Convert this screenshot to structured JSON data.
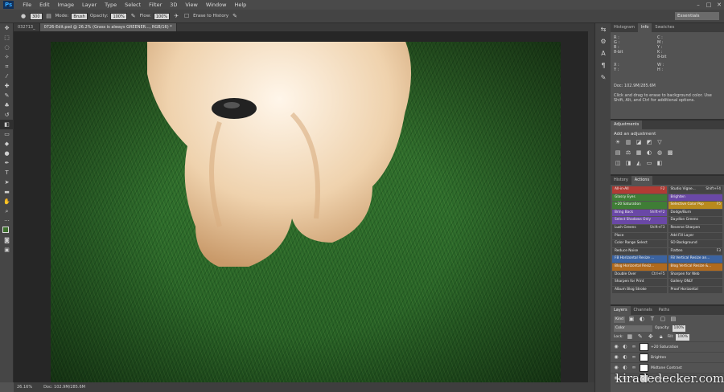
{
  "app": {
    "logo": "Ps"
  },
  "menu": [
    "File",
    "Edit",
    "Image",
    "Layer",
    "Type",
    "Select",
    "Filter",
    "3D",
    "View",
    "Window",
    "Help"
  ],
  "window_controls": [
    "–",
    "□",
    "✕"
  ],
  "options": {
    "size": "300",
    "mode_label": "Mode:",
    "mode_value": "Brush",
    "opacity_label": "Opacity:",
    "opacity_value": "100%",
    "flow_label": "Flow:",
    "flow_value": "100%",
    "erase_history": "Erase to History",
    "workspace": "Essentials"
  },
  "doc_tabs": [
    {
      "label": "032713_"
    },
    {
      "label": "0726-Edit.psd @ 26.2% (Grass is always GREENER..., RGB/16) *"
    }
  ],
  "status": {
    "zoom": "26.16%",
    "doc": "Doc: 102.9M/285.6M"
  },
  "info_panel": {
    "tabs": [
      "Histogram",
      "Info",
      "Swatches"
    ],
    "active_tab": "Info",
    "rgb_labels": [
      "R :",
      "G :",
      "B :"
    ],
    "bit_left": "8-bit",
    "cmyk_labels": [
      "C :",
      "M :",
      "Y :",
      "K :"
    ],
    "bit_right": "8-bit",
    "xy_labels": [
      "X :",
      "Y :"
    ],
    "wh_labels": [
      "W :",
      "H :"
    ],
    "doc": "Doc: 102.9M/285.6M",
    "hint": "Click and drag to erase to background color.  Use Shift, Alt, and Ctrl for additional options."
  },
  "adjustments": {
    "tab": "Adjustments",
    "title": "Add an adjustment"
  },
  "actions_panel": {
    "tabs": [
      "History",
      "Actions"
    ],
    "active_tab": "Actions",
    "items": [
      {
        "label": "All-in-All",
        "shortcut": "F2",
        "color": "#b03b34"
      },
      {
        "label": "Studio Vigne...",
        "shortcut": "Shift+F4",
        "color": "#444444"
      },
      {
        "label": "Glassy Eyes",
        "shortcut": "",
        "color": "#3f7d36"
      },
      {
        "label": "Brighten",
        "shortcut": "",
        "color": "#6a48a6"
      },
      {
        "label": "+20 Saturation",
        "shortcut": "",
        "color": "#3f7d36"
      },
      {
        "label": "Selective Color Pop",
        "shortcut": "F5",
        "color": "#b88a1e"
      },
      {
        "label": "Bring Back",
        "shortcut": "Shift+F2",
        "color": "#6a48a6"
      },
      {
        "label": "Dodge/Burn",
        "shortcut": "",
        "color": "#444444"
      },
      {
        "label": "Select Shadows Only",
        "shortcut": "",
        "color": "#6a48a6"
      },
      {
        "label": "Daydlon Greens",
        "shortcut": "",
        "color": "#444444"
      },
      {
        "label": "Lush Greens",
        "shortcut": "Shift+F3",
        "color": "#444444"
      },
      {
        "label": "Reverse Sharpen",
        "shortcut": "",
        "color": "#444444"
      },
      {
        "label": "Place",
        "shortcut": "",
        "color": "#444444"
      },
      {
        "label": "Add Fill Layer",
        "shortcut": "",
        "color": "#444444"
      },
      {
        "label": "Color Range Select",
        "shortcut": "",
        "color": "#444444"
      },
      {
        "label": "SO Background",
        "shortcut": "",
        "color": "#444444"
      },
      {
        "label": "Reduce Noise",
        "shortcut": "",
        "color": "#444444"
      },
      {
        "label": "Flatten",
        "shortcut": "F3",
        "color": "#444444"
      },
      {
        "label": "FB Horizontal Resize ...",
        "shortcut": "",
        "color": "#3b63a0"
      },
      {
        "label": "FB Vertical Resize an...",
        "shortcut": "",
        "color": "#3b63a0"
      },
      {
        "label": "Blog Horizontal Resiz...",
        "shortcut": "",
        "color": "#b06a1e"
      },
      {
        "label": "Blog Vertical Resize &...",
        "shortcut": "",
        "color": "#b06a1e"
      },
      {
        "label": "Double Over",
        "shortcut": "Ctrl+F5",
        "color": "#444444"
      },
      {
        "label": "Sharpen for Web",
        "shortcut": "",
        "color": "#444444"
      },
      {
        "label": "Sharpen for Print",
        "shortcut": "",
        "color": "#444444"
      },
      {
        "label": "Gallery ONLY",
        "shortcut": "",
        "color": "#444444"
      },
      {
        "label": "Album Blog Stroke",
        "shortcut": "",
        "color": "#444444"
      },
      {
        "label": "Proof Horizontal",
        "shortcut": "",
        "color": "#444444"
      }
    ]
  },
  "layers_panel": {
    "tabs": [
      "Layers",
      "Channels",
      "Paths"
    ],
    "active_tab": "Layers",
    "kind": "Kind",
    "blend_mode": "Color",
    "opacity_label": "Opacity:",
    "opacity_value": "100%",
    "lock_label": "Lock:",
    "fill_label": "Fill:",
    "fill_value": "100%",
    "layers": [
      {
        "name": "+20 Saturation",
        "thumb": "#4a4a4a"
      },
      {
        "name": "Brighten",
        "thumb": "#4a4a4a"
      },
      {
        "name": "Midtone Contrast",
        "thumb": "#4a4a4a"
      },
      {
        "name": "Levels 1",
        "thumb": "#4a4a4a"
      }
    ]
  },
  "watermark": "kiradedecker.com"
}
